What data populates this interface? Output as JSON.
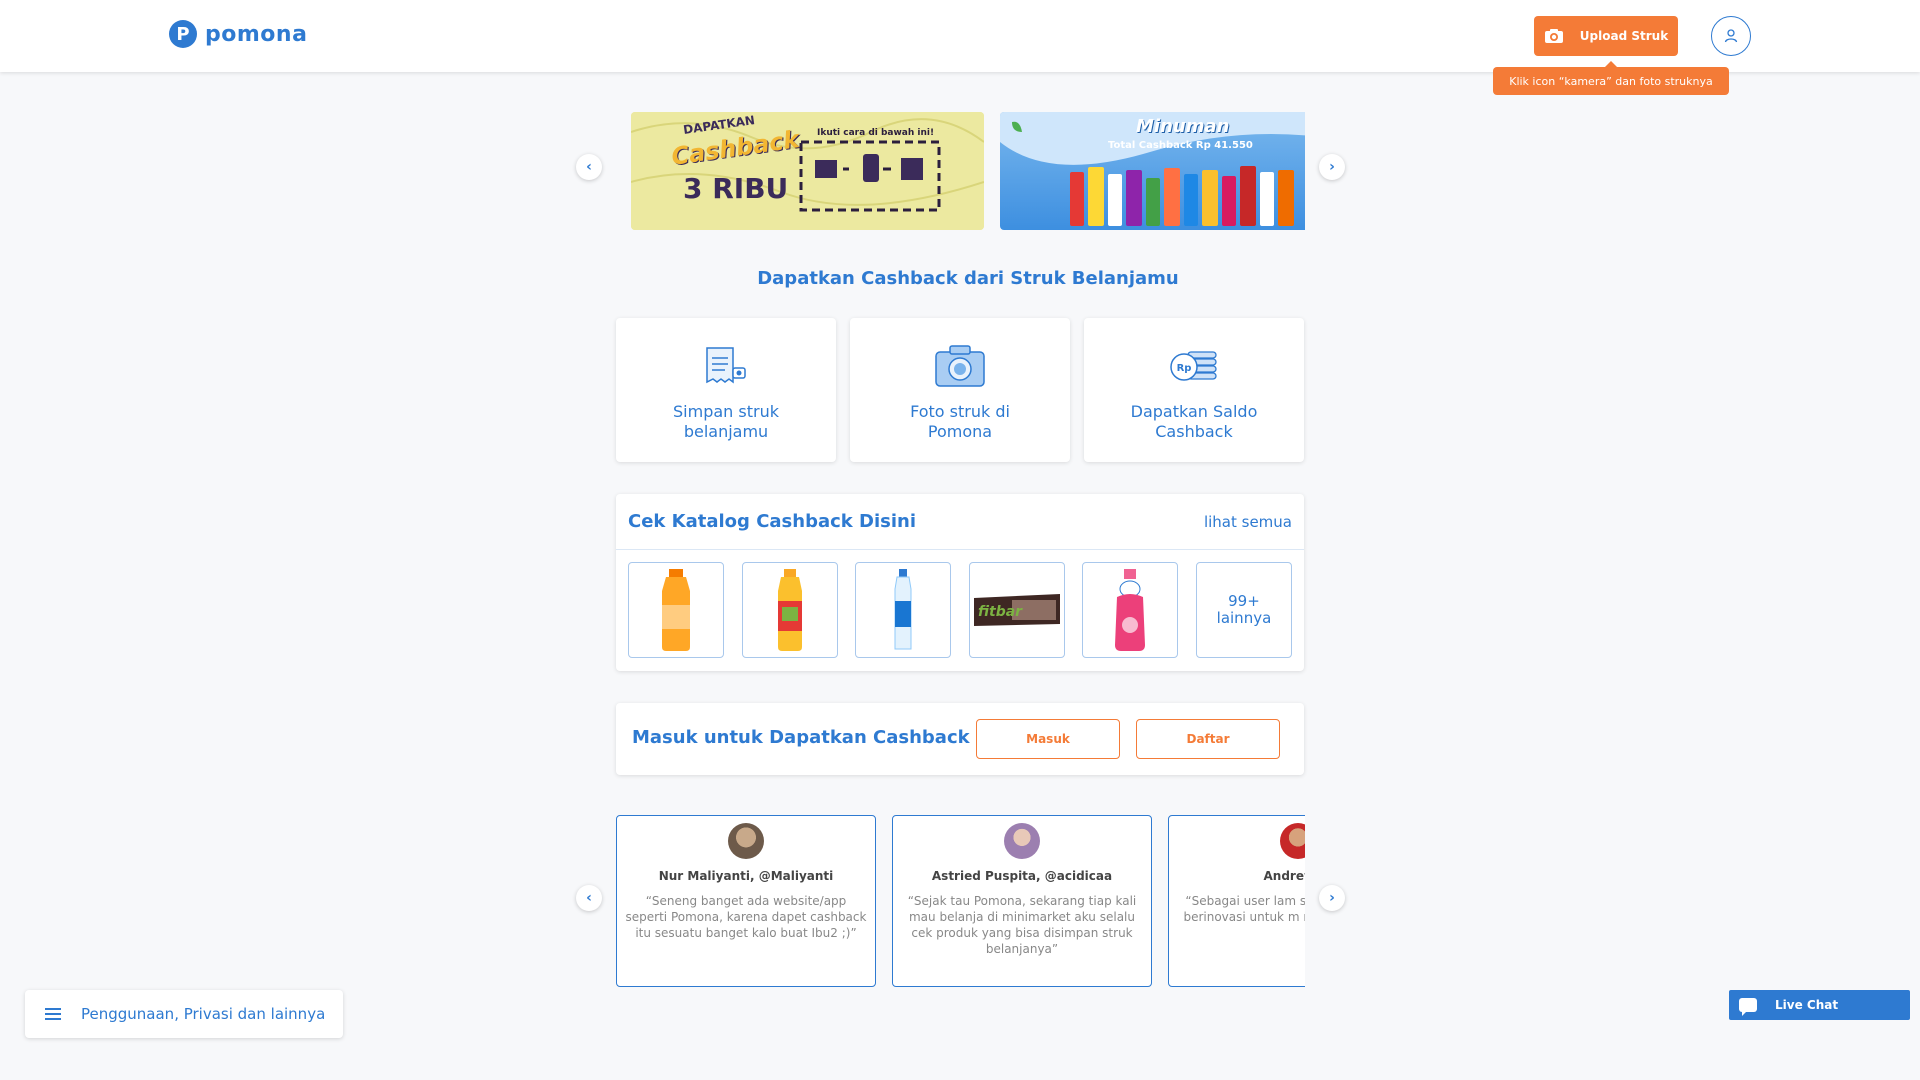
{
  "header": {
    "logo_mark": "P",
    "logo_text": "pomona",
    "upload_label": "Upload Struk",
    "tooltip": "Klik icon “kamera” dan foto struknya"
  },
  "banners": {
    "banner1_lines": [
      "DAPATKAN",
      "Cashback",
      "3 RIBU"
    ],
    "banner1_hint": "Ikuti cara di bawah ini!",
    "banner2_title": "Minuman",
    "banner2_subtitle": "Total Cashback Rp 41.550"
  },
  "section_title": "Dapatkan Cashback dari Struk Belanjamu",
  "steps": [
    {
      "label": "Simpan struk belanjamu",
      "icon": "receipt-icon"
    },
    {
      "label": "Foto struk di Pomona",
      "icon": "camera-icon"
    },
    {
      "label": "Dapatkan Saldo Cashback",
      "icon": "coins-icon"
    }
  ],
  "catalog": {
    "title": "Cek Katalog Cashback Disini",
    "see_all": "lihat semua",
    "items": [
      "orange-juice-bottle",
      "tea-bottle",
      "water-bottle",
      "fitbar-snack",
      "pink-milk-bottle"
    ],
    "more_count": "99+",
    "more_label": "lainnya"
  },
  "login": {
    "title": "Masuk untuk Dapatkan Cashback",
    "login_label": "Masuk",
    "register_label": "Daftar"
  },
  "testimonials": [
    {
      "name": "Nur Maliyanti, @Maliyanti",
      "text": "“Seneng banget ada website/app seperti Pomona, karena dapet cashback itu sesuatu banget kalo buat Ibu2 ;)”"
    },
    {
      "name": "Astried Puspita, @acidicaa",
      "text": "“Sejak tau Pomona, sekarang tiap kali mau belanja di minimarket aku selalu cek produk yang bisa disimpan struk belanjanya”"
    },
    {
      "name": "Andrew W",
      "text": "“Sebagai user lam senang dengan Po berinovasi untuk m mengikuti perkem"
    }
  ],
  "footer": {
    "menu_label": "Penggunaan, Privasi dan lainnya"
  },
  "live_chat": {
    "label": "Live Chat"
  },
  "colors": {
    "brand_blue": "#2e7ad1",
    "accent_orange": "#f47b37"
  }
}
